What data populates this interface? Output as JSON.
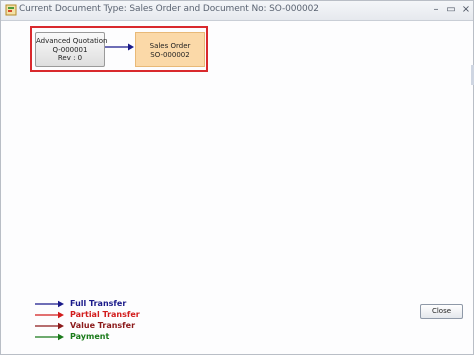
{
  "window": {
    "title": "Current Document Type: Sales Order and Document No: SO-000002",
    "controls": {
      "minimize": "–",
      "maximize": "▭",
      "close": "×"
    }
  },
  "flow": {
    "documents": [
      {
        "type": "Advanced Quotation",
        "number": "Q-000001",
        "revision": "Rev : 0"
      },
      {
        "type": "Sales Order",
        "number": "SO-000002"
      }
    ]
  },
  "legend": [
    {
      "label": "Full Transfer",
      "color": "#1a1a8a"
    },
    {
      "label": "Partial Transfer",
      "color": "#d21c1c"
    },
    {
      "label": "Value Transfer",
      "color": "#8b1a1a"
    },
    {
      "label": "Payment",
      "color": "#1a7a1a"
    }
  ],
  "colors": {
    "current_document": "#fbd9a8",
    "highlight_frame": "#d9292d",
    "flow_arrow": "#1a1a8a"
  },
  "buttons": {
    "close": "Close"
  }
}
